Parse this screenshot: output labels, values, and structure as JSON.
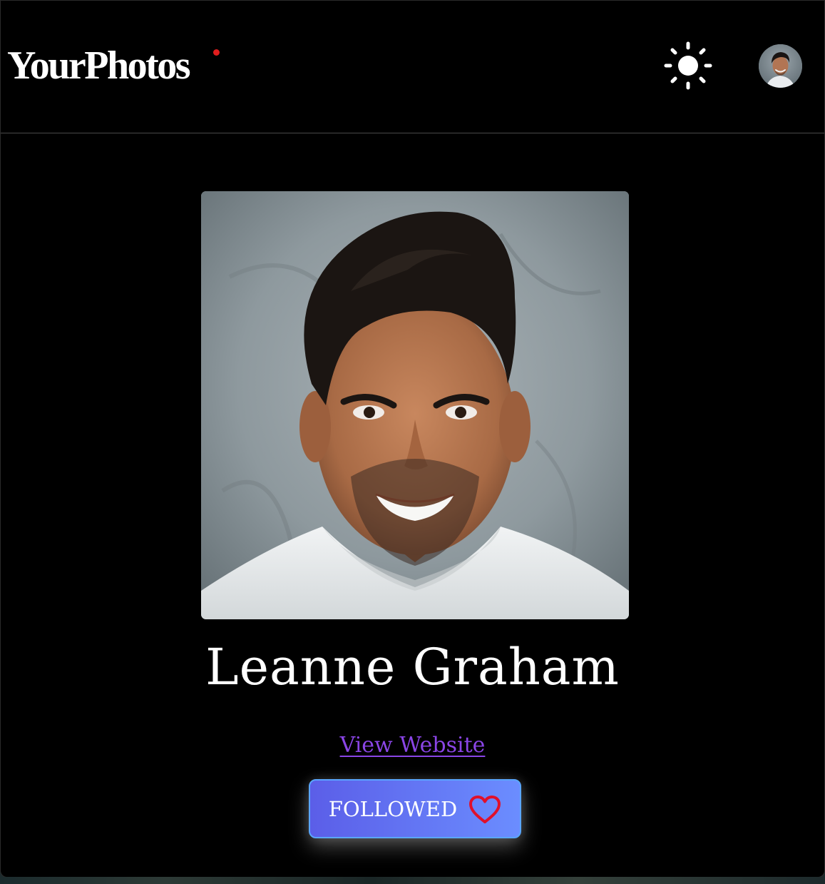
{
  "header": {
    "logo_text": "YourPhotos",
    "theme_toggle_icon": "sun-icon",
    "avatar_alt": "user avatar"
  },
  "profile": {
    "name": "Leanne Graham",
    "website_link_text": "View Website",
    "follow_button_label": "FOLLOWED",
    "follow_icon": "heart-icon"
  },
  "colors": {
    "background": "#000000",
    "logo_dot": "#e01d1d",
    "link": "#8a45e6",
    "button_gradient_start": "#5b5ee8",
    "button_gradient_end": "#6b8dff",
    "heart": "#e0102b"
  }
}
